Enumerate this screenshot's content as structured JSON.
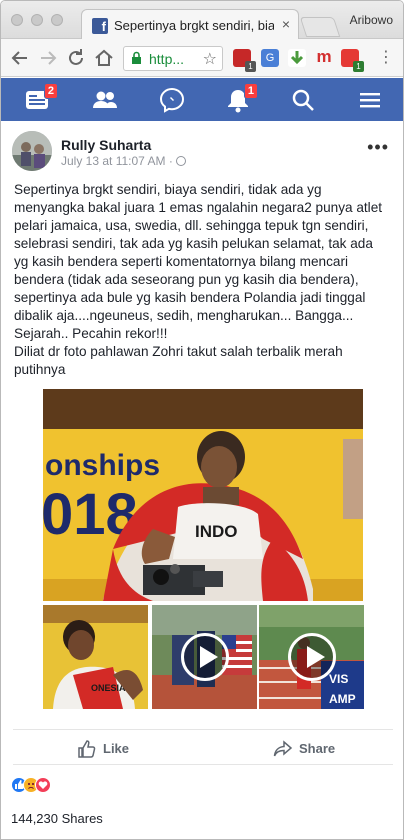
{
  "browser": {
    "tab_title": "Sepertinya brgkt sendiri, biaya",
    "tab_close": "×",
    "profile_name": "Aribowo",
    "url_display": "http...",
    "ext_badge_1": "1",
    "ext_badge_2": "1",
    "ext_m": "m"
  },
  "fb_nav": {
    "feed_badge": "2",
    "notifications_badge": "1"
  },
  "post": {
    "author": "Rully Suharta",
    "timestamp": "July 13 at 11:07 AM · ",
    "more": "•••",
    "text": "Sepertinya brgkt sendiri, biaya sendiri, tidak ada yg\nmenyangka bakal juara 1 emas ngalahin negara2 punya atlet\npelari jamaica, usa, swedia, dll. sehingga tepuk tgn sendiri,\nselebrasi sendiri, tak ada yg kasih pelukan selamat, tak ada\nyg kasih bendera seperti komentatornya bilang mencari\nbendera (tidak ada seseorang pun yg kasih dia bendera),\nsepertinya ada bule yg kasih bendera Polandia jadi tinggal\ndibalik aja....ngeuneus, sedih, mengharukan... Bangga...\nSejarah.. Pecahin rekor!!!\nDiliat dr foto pahlawan Zohri takut salah terbalik merah\nputihnya",
    "photo_banner_text": "onships",
    "photo_year_text": "018",
    "photo_shirt_text": "INDO",
    "thumb1_shirt_text": "ONESIA",
    "thumb3_banner_text": "VIS",
    "thumb3_banner_text2": "AMP",
    "like_label": "Like",
    "share_label": "Share",
    "shares_count": "144,230 Shares"
  },
  "colors": {
    "facebook_blue": "#4267b2",
    "badge_red": "#fa3e3e",
    "secure_green": "#1a8d3b"
  }
}
